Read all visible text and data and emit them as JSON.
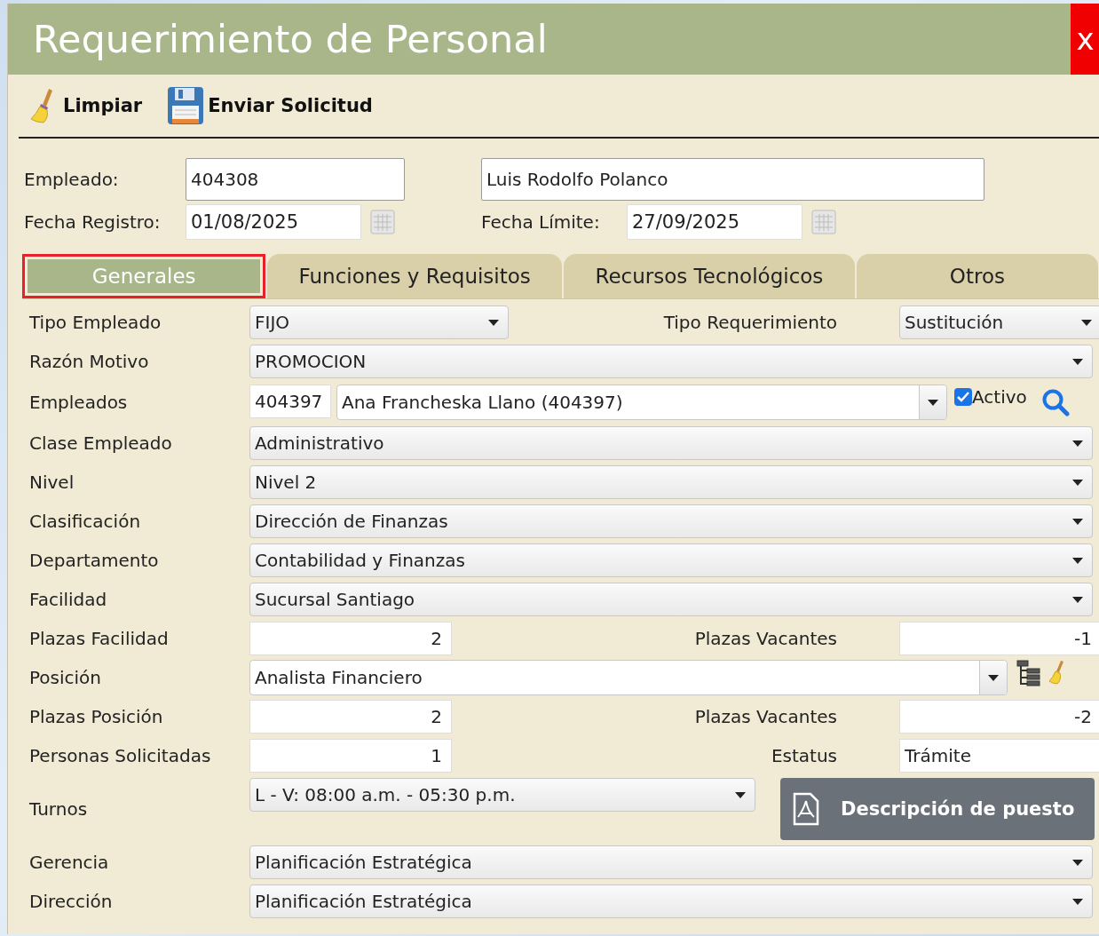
{
  "window": {
    "title": "Requerimiento de Personal",
    "close_label": "x"
  },
  "toolbar": [
    {
      "kind": "broom",
      "label": "Limpiar"
    },
    {
      "kind": "save",
      "label": "Enviar Solicitud"
    }
  ],
  "header": {
    "employee_label": "Empleado:",
    "employee_id": "404308",
    "employee_name": "Luis Rodolfo Polanco",
    "registered_label": "Fecha Registro:",
    "registered_date": "01/08/2025",
    "deadline_label": "Fecha Límite:",
    "deadline_date": "27/09/2025"
  },
  "tabs": [
    {
      "label": "Generales",
      "selected": true
    },
    {
      "label": "Funciones y Requisitos",
      "selected": false
    },
    {
      "label": "Recursos Tecnológicos",
      "selected": false
    },
    {
      "label": "Otros",
      "selected": false
    }
  ],
  "form": {
    "rows": [
      {
        "kind": "select_pair",
        "label": "Tipo Empleado",
        "value": "FIJO",
        "label_2": "Tipo Requerimiento",
        "value_2": "Sustitución"
      },
      {
        "kind": "select",
        "label": "Razón Motivo",
        "value": "PROMOCION"
      },
      {
        "kind": "employee",
        "label": "Empleados",
        "code": "404397",
        "value": "Ana Francheska Llano (404397)",
        "checkbox_label": "Activo",
        "checked": true
      },
      {
        "kind": "select",
        "label": "Clase Empleado",
        "value": "Administrativo"
      },
      {
        "kind": "select",
        "label": "Nivel",
        "value": "Nivel 2"
      },
      {
        "kind": "select",
        "label": "Clasificación",
        "value": "Dirección de Finanzas"
      },
      {
        "kind": "select",
        "label": "Departamento",
        "value": "Contabilidad y Finanzas"
      },
      {
        "kind": "select",
        "label": "Facilidad",
        "value": "Sucursal Santiago"
      },
      {
        "kind": "number_pair",
        "label": "Plazas Facilidad",
        "value": "2",
        "label_2": "Plazas Vacantes",
        "value_2": "-1"
      },
      {
        "kind": "position",
        "label": "Posición",
        "value": "Analista Financiero"
      },
      {
        "kind": "number_pair",
        "label": "Plazas Posición",
        "value": "2",
        "label_2": "Plazas Vacantes",
        "value_2": "-2"
      },
      {
        "kind": "number_text",
        "label": "Personas Solicitadas",
        "value": "1",
        "label_2": "Estatus",
        "value_2": "Trámite"
      },
      {
        "kind": "shift",
        "label": "Turnos",
        "value": "L - V: 08:00 a.m. - 05:30 p.m.",
        "button": "Descripción de puesto"
      },
      {
        "kind": "select",
        "label": "Gerencia",
        "value": "Planificación Estratégica"
      },
      {
        "kind": "select",
        "label": "Dirección",
        "value": "Planificación Estratégica"
      }
    ]
  }
}
